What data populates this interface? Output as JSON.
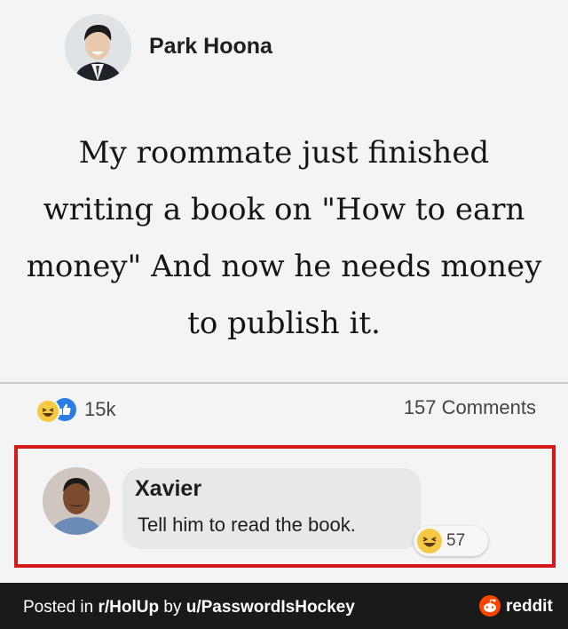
{
  "post": {
    "author": "Park Hoona",
    "text_lines": [
      "My roommate just finished",
      "writing a book on \"How to earn",
      "money\" And now he needs money",
      "to publish it."
    ],
    "reaction_count": "15k",
    "comments_count": "157 Comments",
    "reaction_icons": [
      "haha-icon",
      "like-icon"
    ]
  },
  "comment": {
    "author": "Xavier",
    "text": "Tell him to read the book.",
    "reaction_count": "57",
    "reaction_icon": "haha-icon"
  },
  "footer": {
    "prefix": "Posted in ",
    "subreddit": "r/HolUp",
    "by": " by ",
    "user": "u/PasswordIsHockey",
    "brand": "reddit"
  },
  "colors": {
    "highlight": "#d51818",
    "like": "#2a7ee3",
    "haha": "#f6c945",
    "footer_bg": "#1a1a1b",
    "reddit": "#ff4500"
  }
}
